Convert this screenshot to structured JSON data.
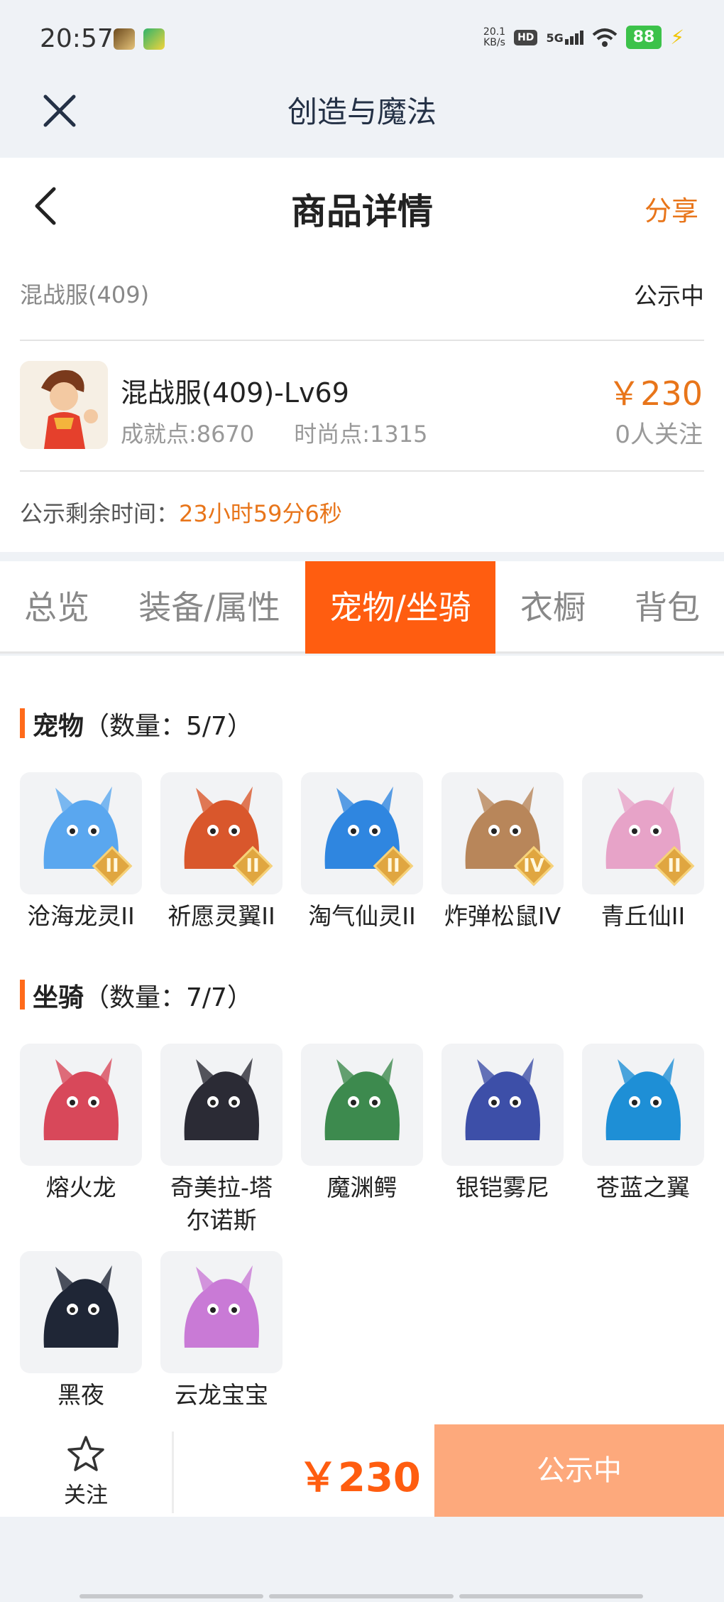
{
  "status_bar": {
    "time": "20:57",
    "net_speed": "20.1",
    "net_unit": "KB/s",
    "hd": "HD",
    "network": "5G",
    "battery": "88"
  },
  "app_header": {
    "title": "创造与魔法"
  },
  "nav": {
    "title": "商品详情",
    "share": "分享"
  },
  "listing": {
    "server": "混战服(409)",
    "status": "公示中",
    "name": "混战服(409)-Lv69",
    "achievement": "成就点:8670",
    "fashion": "时尚点:1315",
    "price": "￥230",
    "followers": "0人关注",
    "countdown_label": "公示剩余时间：",
    "countdown_value": "23小时59分6秒"
  },
  "tabs": [
    {
      "label": "总览"
    },
    {
      "label": "装备/属性"
    },
    {
      "label": "宠物/坐骑"
    },
    {
      "label": "衣橱"
    },
    {
      "label": "背包"
    }
  ],
  "active_tab": 2,
  "pets": {
    "title": "宠物",
    "count": "（数量：5/7）",
    "items": [
      {
        "name": "沧海龙灵II",
        "grade": "II",
        "color": "#5aa7ef"
      },
      {
        "name": "祈愿灵翼II",
        "grade": "II",
        "color": "#d9572c"
      },
      {
        "name": "淘气仙灵II",
        "grade": "II",
        "color": "#2f86e0"
      },
      {
        "name": "炸弹松鼠IV",
        "grade": "IV",
        "color": "#b8865a"
      },
      {
        "name": "青丘仙II",
        "grade": "II",
        "color": "#e7a3c8"
      }
    ]
  },
  "mounts": {
    "title": "坐骑",
    "count": "（数量：7/7）",
    "items": [
      {
        "name": "熔火龙",
        "color": "#d8485a"
      },
      {
        "name": "奇美拉-塔尔诺斯",
        "color": "#2b2b35"
      },
      {
        "name": "魔渊鳄",
        "color": "#3d8a4e"
      },
      {
        "name": "银铠雾尼",
        "color": "#3d4fa8"
      },
      {
        "name": "苍蓝之翼",
        "color": "#1e8fd6"
      },
      {
        "name": "黑夜",
        "color": "#1f2636"
      },
      {
        "name": "云龙宝宝",
        "color": "#c97ad6"
      }
    ]
  },
  "bottom_bar": {
    "follow": "关注",
    "price": "￥230",
    "status": "公示中"
  }
}
